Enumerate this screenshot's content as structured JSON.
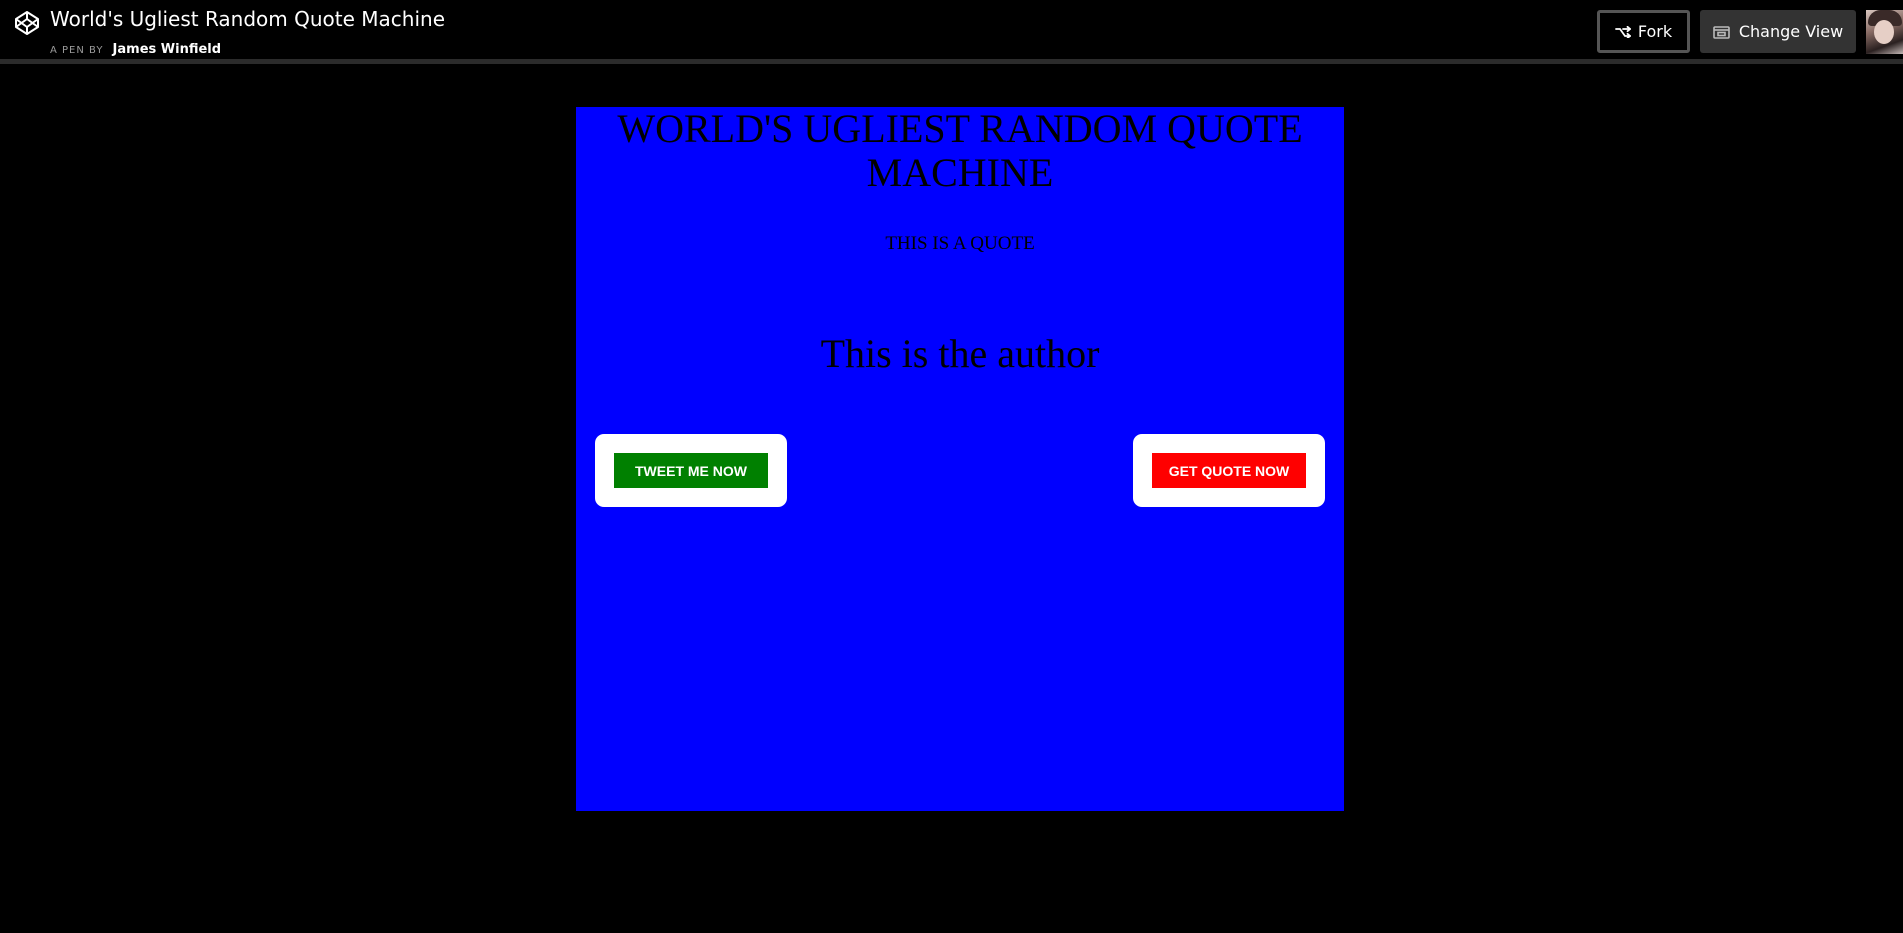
{
  "header": {
    "logo_icon": "codepen-logo-icon",
    "title": "World's Ugliest Random Quote Machine",
    "byline_prefix": "A PEN BY",
    "author": "James Winfield",
    "fork_label": "Fork",
    "fork_icon": "fork-icon",
    "change_view_label": "Change View",
    "change_view_icon": "view-icon",
    "avatar": "user-avatar"
  },
  "pen": {
    "heading": "WORLD'S UGLIEST RANDOM QUOTE MACHINE",
    "quote": "THIS IS A QUOTE",
    "author": "This is the author",
    "tweet_button": "TWEET ME NOW",
    "get_quote_button": "GET QUOTE NOW",
    "colors": {
      "background": "#0000ff",
      "tweet_button": "#008000",
      "get_quote_button": "#ff0000",
      "page_background": "#000000"
    }
  }
}
